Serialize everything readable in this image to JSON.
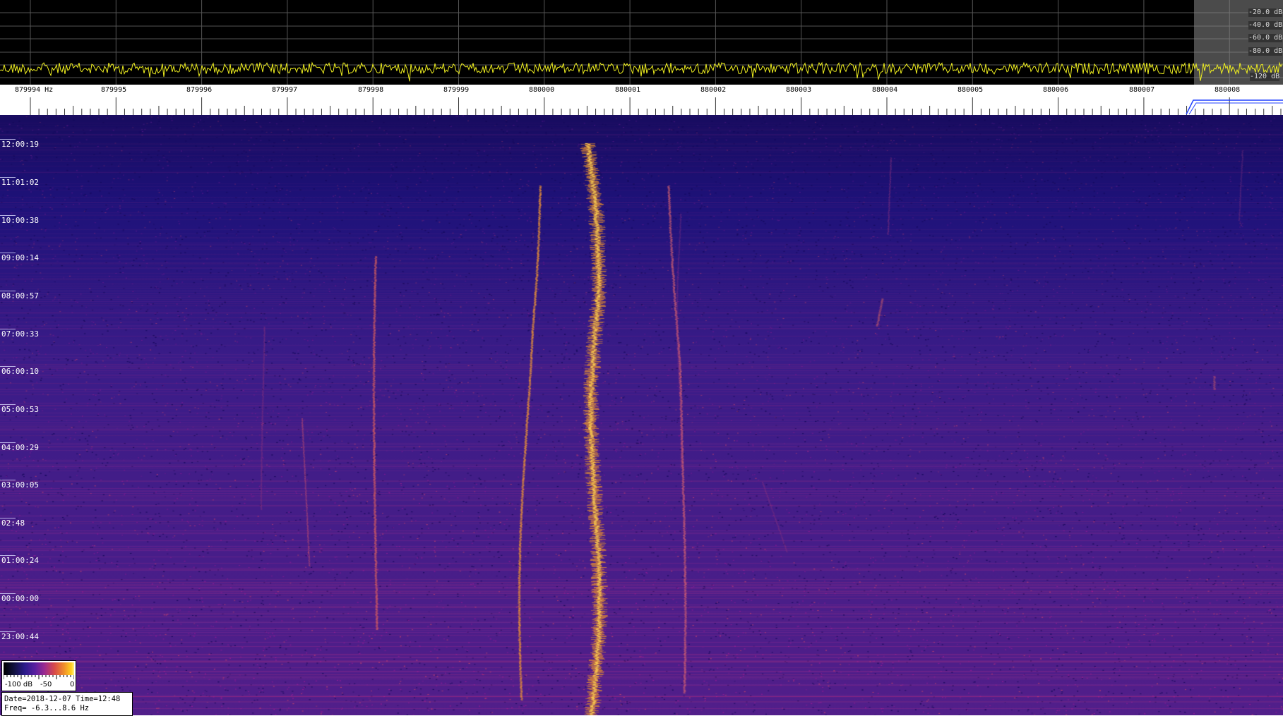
{
  "spectrum": {
    "db_labels": [
      "-20.0 dB",
      "-40.0 dB",
      "-60.0 dB",
      "-80.0 dB",
      "-120 dB"
    ],
    "trace_color": "#f0f020"
  },
  "frequency_axis": {
    "labels": [
      "879994 Hz",
      "879995",
      "879996",
      "879997",
      "879998",
      "879999",
      "880000",
      "880001",
      "880002",
      "880003",
      "880004",
      "880005",
      "880006",
      "880007",
      "880008"
    ]
  },
  "waterfall": {
    "time_labels": [
      "12:00:19",
      "11:01:02",
      "10:00:38",
      "09:00:14",
      "08:00:57",
      "07:00:33",
      "06:00:10",
      "05:00:53",
      "04:00:29",
      "03:00:05",
      "02:48",
      "01:00:24",
      "00:00:00",
      "23:00:44"
    ],
    "colors": {
      "background": "#1a0f6e",
      "trace_hot": "#f0a030",
      "trace_mid": "#d060a0"
    }
  },
  "legend": {
    "labels": [
      "-100 dB",
      "-50",
      "0"
    ]
  },
  "info": {
    "line1": "Date=2018-12-07 Time=12:48",
    "line2": "Freq= -6.3...8.6 Hz"
  }
}
